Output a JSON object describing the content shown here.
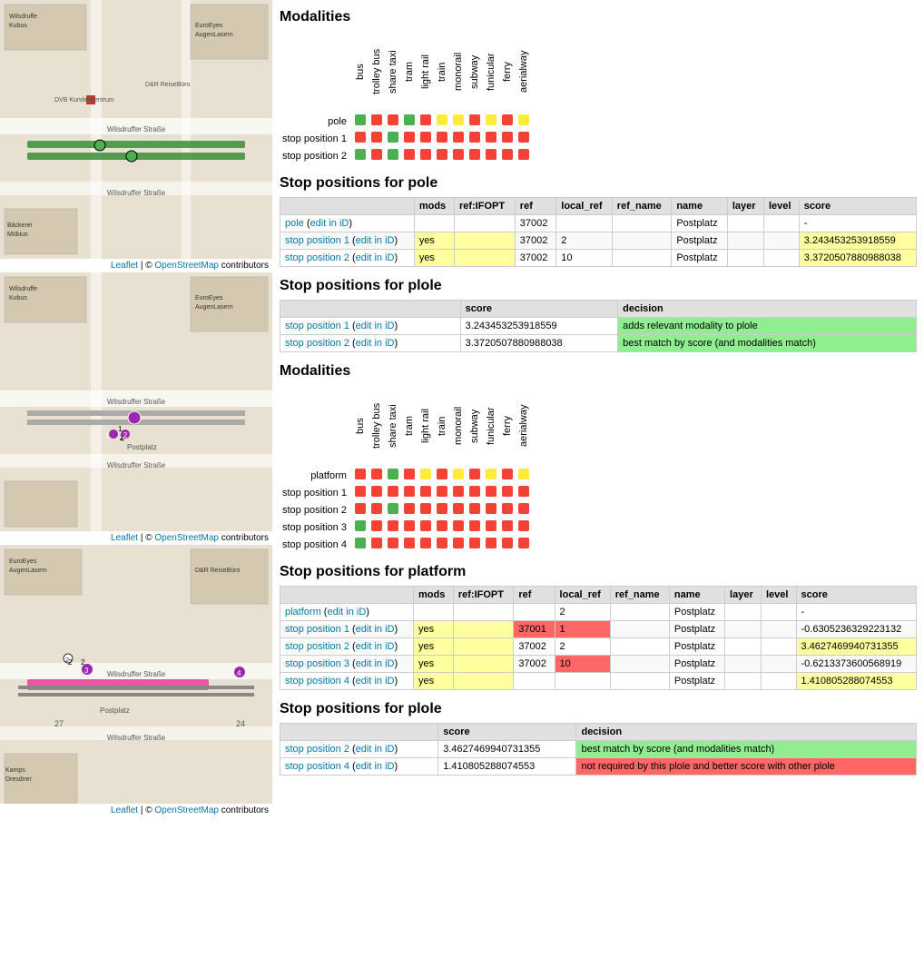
{
  "maps": [
    {
      "id": "map-top",
      "footer": "Leaflet | © OpenStreetMap contributors"
    },
    {
      "id": "map-middle",
      "footer": "Leaflet | © OpenStreetMap contributors"
    },
    {
      "id": "map-bottom",
      "footer": "Leaflet | © OpenStreetMap contributors"
    }
  ],
  "section1": {
    "title": "Modalities",
    "columns": [
      "bus",
      "trolley bus",
      "share taxi",
      "tram",
      "light rail",
      "train",
      "monorail",
      "subway",
      "funicular",
      "ferry",
      "aerialway"
    ],
    "rows": [
      {
        "label": "pole",
        "dots": [
          "green",
          "red",
          "red",
          "green",
          "red",
          "yellow",
          "yellow",
          "red",
          "yellow",
          "red",
          "yellow"
        ]
      },
      {
        "label": "stop position 1",
        "dots": [
          "red",
          "red",
          "green",
          "red",
          "red",
          "red",
          "red",
          "red",
          "red",
          "red",
          "red"
        ]
      },
      {
        "label": "stop position 2",
        "dots": [
          "green",
          "red",
          "green",
          "red",
          "red",
          "red",
          "red",
          "red",
          "red",
          "red",
          "red"
        ]
      }
    ]
  },
  "section2": {
    "title": "Stop positions for pole",
    "columns": [
      "mods",
      "ref:IFOPT",
      "ref",
      "local_ref",
      "ref_name",
      "name",
      "layer",
      "level",
      "score"
    ],
    "rows": [
      {
        "link_text": "pole",
        "link_edit": "edit in iD",
        "mods": "",
        "ref_ifopt": "",
        "ref": "37002",
        "local_ref": "",
        "ref_name": "",
        "name": "Postplatz",
        "layer": "",
        "level": "",
        "score": "-",
        "row_class": ""
      },
      {
        "link_text": "stop position 1",
        "link_edit": "edit in iD",
        "mods": "yes",
        "ref_ifopt": "",
        "ref": "37002",
        "local_ref": "2",
        "ref_name": "",
        "name": "Postplatz",
        "layer": "",
        "level": "",
        "score": "3.243453253918559",
        "row_class": "yellow"
      },
      {
        "link_text": "stop position 2",
        "link_edit": "edit in iD",
        "mods": "yes",
        "ref_ifopt": "",
        "ref": "37002",
        "local_ref": "10",
        "ref_name": "",
        "name": "Postplatz",
        "layer": "",
        "level": "",
        "score": "3.3720507880988038",
        "row_class": "yellow"
      }
    ]
  },
  "section3": {
    "title": "Stop positions for plole",
    "columns": [
      "score",
      "decision"
    ],
    "rows": [
      {
        "link_text": "stop position 1",
        "link_edit": "edit in iD",
        "score": "3.243453253918559",
        "decision": "adds relevant modality to plole",
        "decision_class": "green"
      },
      {
        "link_text": "stop position 2",
        "link_edit": "edit in iD",
        "score": "3.3720507880988038",
        "decision": "best match by score (and modalities match)",
        "decision_class": "green"
      }
    ]
  },
  "section4": {
    "title": "Modalities",
    "columns": [
      "bus",
      "trolley bus",
      "share taxi",
      "tram",
      "light rail",
      "train",
      "monorail",
      "subway",
      "funicular",
      "ferry",
      "aerialway"
    ],
    "rows": [
      {
        "label": "platform",
        "dots": [
          "red",
          "red",
          "green",
          "red",
          "yellow",
          "red",
          "yellow",
          "red",
          "yellow",
          "red",
          "yellow"
        ]
      },
      {
        "label": "stop position 1",
        "dots": [
          "red",
          "red",
          "red",
          "red",
          "red",
          "red",
          "red",
          "red",
          "red",
          "red",
          "red"
        ]
      },
      {
        "label": "stop position 2",
        "dots": [
          "red",
          "red",
          "green",
          "red",
          "red",
          "red",
          "red",
          "red",
          "red",
          "red",
          "red"
        ]
      },
      {
        "label": "stop position 3",
        "dots": [
          "green",
          "red",
          "red",
          "red",
          "red",
          "red",
          "red",
          "red",
          "red",
          "red",
          "red"
        ]
      },
      {
        "label": "stop position 4",
        "dots": [
          "green",
          "red",
          "red",
          "red",
          "red",
          "red",
          "red",
          "red",
          "red",
          "red",
          "red"
        ]
      }
    ]
  },
  "section5": {
    "title": "Stop positions for platform",
    "columns": [
      "mods",
      "ref:IFOPT",
      "ref",
      "local_ref",
      "ref_name",
      "name",
      "layer",
      "level",
      "score"
    ],
    "rows": [
      {
        "link_text": "platform",
        "link_edit": "edit in iD",
        "mods": "",
        "ref_ifopt": "",
        "ref": "",
        "local_ref": "2",
        "ref_name": "",
        "name": "Postplatz",
        "layer": "",
        "level": "",
        "score": "-",
        "ref_color": ""
      },
      {
        "link_text": "stop position 1",
        "link_edit": "edit in iD",
        "mods": "yes",
        "ref_ifopt": "",
        "ref": "37001",
        "local_ref": "1",
        "ref_name": "",
        "name": "Postplatz",
        "layer": "",
        "level": "",
        "score": "-0.6305236329223132",
        "ref_color": "red",
        "local_ref_color": "red"
      },
      {
        "link_text": "stop position 2",
        "link_edit": "edit in iD",
        "mods": "yes",
        "ref_ifopt": "",
        "ref": "37002",
        "local_ref": "2",
        "ref_name": "",
        "name": "Postplatz",
        "layer": "",
        "level": "",
        "score": "3.4627469940731355",
        "ref_color": "",
        "local_ref_color": ""
      },
      {
        "link_text": "stop position 3",
        "link_edit": "edit in iD",
        "mods": "yes",
        "ref_ifopt": "",
        "ref": "37002",
        "local_ref": "10",
        "ref_name": "",
        "name": "Postplatz",
        "layer": "",
        "level": "",
        "score": "-0.6213373600568919",
        "ref_color": "",
        "local_ref_color": "red"
      },
      {
        "link_text": "stop position 4",
        "link_edit": "edit in iD",
        "mods": "yes",
        "ref_ifopt": "",
        "ref": "",
        "local_ref": "",
        "ref_name": "",
        "name": "Postplatz",
        "layer": "",
        "level": "",
        "score": "1.410805288074553",
        "ref_color": "",
        "local_ref_color": ""
      }
    ]
  },
  "section6": {
    "title": "Stop positions for plole",
    "columns": [
      "score",
      "decision"
    ],
    "rows": [
      {
        "link_text": "stop position 2",
        "link_edit": "edit in iD",
        "score": "3.4627469940731355",
        "decision": "best match by score (and modalities match)",
        "decision_class": "green"
      },
      {
        "link_text": "stop position 4",
        "link_edit": "edit in iD",
        "score": "1.410805288074553",
        "decision": "not required by this plole and better score with other plole",
        "decision_class": "red"
      }
    ]
  }
}
